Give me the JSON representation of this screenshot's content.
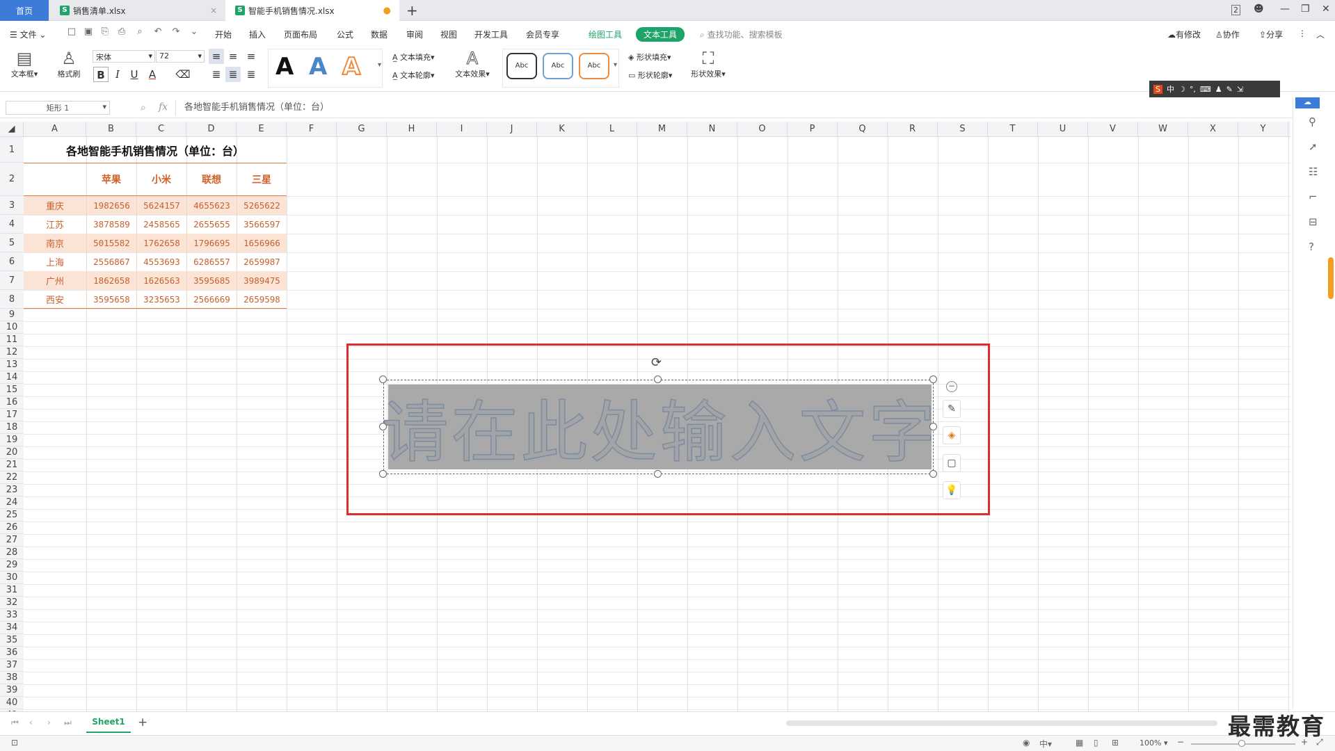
{
  "tabs": {
    "home": "首页",
    "file1": "销售清单.xlsx",
    "file2": "智能手机销售情况.xlsx"
  },
  "menu": {
    "file": "文件",
    "items": [
      "开始",
      "插入",
      "页面布局",
      "公式",
      "数据",
      "审阅",
      "视图",
      "开发工具",
      "会员专享"
    ],
    "drawing_tools": "绘图工具",
    "text_tools": "文本工具",
    "search_placeholder": "查找功能、搜索模板",
    "has_changes": "有修改",
    "collaborate": "协作",
    "share": "分享"
  },
  "ribbon": {
    "textbox": "文本框",
    "format_painter": "格式刷",
    "font_name": "宋体",
    "font_size": "72",
    "text_fill": "文本填充",
    "text_outline": "文本轮廓",
    "text_effects": "文本效果",
    "style_sample": "Abc",
    "shape_fill": "形状填充",
    "shape_outline": "形状轮廓",
    "shape_effects": "形状效果"
  },
  "formula_bar": {
    "name_box": "矩形 1",
    "fx": "fx",
    "content": "各地智能手机销售情况（单位：台）"
  },
  "ime": {
    "lang": "中"
  },
  "sheet": {
    "columns": [
      "A",
      "B",
      "C",
      "D",
      "E",
      "F",
      "G",
      "H",
      "I",
      "J",
      "K",
      "L",
      "M",
      "N",
      "O",
      "P",
      "Q",
      "R",
      "S",
      "T",
      "U",
      "V",
      "W",
      "X",
      "Y"
    ],
    "title": "各地智能手机销售情况（单位：台）",
    "brands": [
      "苹果",
      "小米",
      "联想",
      "三星"
    ],
    "rows": [
      {
        "city": "重庆",
        "values": [
          "1982656",
          "5624157",
          "4655623",
          "5265622"
        ]
      },
      {
        "city": "江苏",
        "values": [
          "3878589",
          "2458565",
          "2655655",
          "3566597"
        ]
      },
      {
        "city": "南京",
        "values": [
          "5015582",
          "1762658",
          "1796695",
          "1656966"
        ]
      },
      {
        "city": "上海",
        "values": [
          "2556867",
          "4553693",
          "6286557",
          "2659987"
        ]
      },
      {
        "city": "广州",
        "values": [
          "1862658",
          "1626563",
          "3595685",
          "3989475"
        ]
      },
      {
        "city": "西安",
        "values": [
          "3595658",
          "3235653",
          "2566669",
          "2659598"
        ]
      }
    ]
  },
  "textbox": {
    "placeholder": "请在此处输入文字"
  },
  "sheets": {
    "active": "Sheet1",
    "add": "+"
  },
  "status": {
    "zoom": "100%"
  },
  "watermark": "最需教育",
  "colors": {
    "accent_green": "#1ea46a",
    "home_tab": "#3c7bd8",
    "data_orange": "#c8602c",
    "row_band": "#fbe4d6",
    "frame_red": "#e02c2c"
  }
}
